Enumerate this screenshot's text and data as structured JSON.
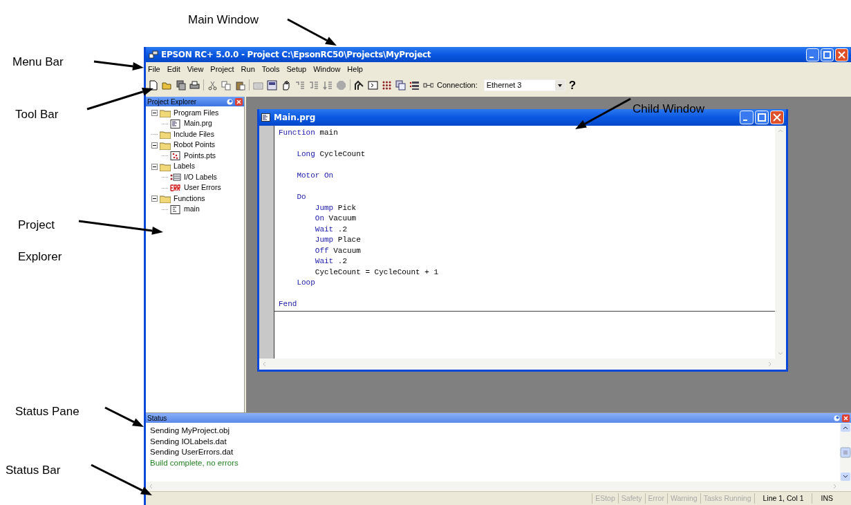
{
  "annotations": [
    {
      "label": "Main Window"
    },
    {
      "label": "Menu Bar"
    },
    {
      "label": "Tool Bar"
    },
    {
      "label": "Child Window"
    },
    {
      "label": "Project Explorer"
    },
    {
      "label": "Status Pane"
    },
    {
      "label": "Status Bar"
    }
  ],
  "window": {
    "title": "EPSON RC+ 5.0.0 - Project C:\\EpsonRC50\\Projects\\MyProject"
  },
  "menu": [
    "File",
    "Edit",
    "View",
    "Project",
    "Run",
    "Tools",
    "Setup",
    "Window",
    "Help"
  ],
  "toolbar": {
    "connection_label": "Connection:",
    "connection_value": "Ethernet 3",
    "help": "?"
  },
  "project_explorer": {
    "title": "Project Explorer",
    "tree": [
      {
        "label": "Program Files",
        "kind": "folder",
        "expanded": true,
        "children": [
          {
            "label": "Main.prg",
            "kind": "program"
          }
        ]
      },
      {
        "label": "Include Files",
        "kind": "folder"
      },
      {
        "label": "Robot Points",
        "kind": "folder",
        "expanded": true,
        "children": [
          {
            "label": "Points.pts",
            "kind": "points"
          }
        ]
      },
      {
        "label": "Labels",
        "kind": "folder",
        "expanded": true,
        "children": [
          {
            "label": "I/O Labels",
            "kind": "io"
          },
          {
            "label": "User Errors",
            "kind": "errors"
          }
        ]
      },
      {
        "label": "Functions",
        "kind": "folder",
        "expanded": true,
        "children": [
          {
            "label": "main",
            "kind": "function"
          }
        ]
      }
    ]
  },
  "editor": {
    "title": "Main.prg",
    "lines": [
      {
        "kind": "code",
        "tokens": [
          {
            "text": "Function",
            "kind": "keyword"
          },
          {
            "text": " main",
            "kind": "plain"
          }
        ]
      },
      {
        "kind": "blank"
      },
      {
        "kind": "code",
        "tokens": [
          {
            "text": "    Long",
            "kind": "keyword"
          },
          {
            "text": " CycleCount",
            "kind": "plain"
          }
        ]
      },
      {
        "kind": "blank"
      },
      {
        "kind": "code",
        "tokens": [
          {
            "text": "    Motor On",
            "kind": "keyword"
          }
        ]
      },
      {
        "kind": "blank"
      },
      {
        "kind": "code",
        "tokens": [
          {
            "text": "    Do",
            "kind": "keyword"
          }
        ]
      },
      {
        "kind": "code",
        "tokens": [
          {
            "text": "        Jump",
            "kind": "keyword"
          },
          {
            "text": " Pick",
            "kind": "plain"
          }
        ]
      },
      {
        "kind": "code",
        "tokens": [
          {
            "text": "        On",
            "kind": "keyword"
          },
          {
            "text": " Vacuum",
            "kind": "plain"
          }
        ]
      },
      {
        "kind": "code",
        "tokens": [
          {
            "text": "        Wait",
            "kind": "keyword"
          },
          {
            "text": " .2",
            "kind": "plain"
          }
        ]
      },
      {
        "kind": "code",
        "tokens": [
          {
            "text": "        Jump",
            "kind": "keyword"
          },
          {
            "text": " Place",
            "kind": "plain"
          }
        ]
      },
      {
        "kind": "code",
        "tokens": [
          {
            "text": "        Off",
            "kind": "keyword"
          },
          {
            "text": " Vacuum",
            "kind": "plain"
          }
        ]
      },
      {
        "kind": "code",
        "tokens": [
          {
            "text": "        Wait",
            "kind": "keyword"
          },
          {
            "text": " .2",
            "kind": "plain"
          }
        ]
      },
      {
        "kind": "code",
        "tokens": [
          {
            "text": "        CycleCount = CycleCount + 1",
            "kind": "plain"
          }
        ]
      },
      {
        "kind": "code",
        "tokens": [
          {
            "text": "    Loop",
            "kind": "keyword"
          }
        ]
      },
      {
        "kind": "blank"
      },
      {
        "kind": "code",
        "tokens": [
          {
            "text": "Fend",
            "kind": "keyword"
          }
        ]
      }
    ]
  },
  "status_pane": {
    "title": "Status",
    "lines": [
      {
        "text": "Sending MyProject.obj",
        "kind": "message"
      },
      {
        "text": "Sending IOLabels.dat",
        "kind": "message"
      },
      {
        "text": "Sending UserErrors.dat",
        "kind": "message"
      },
      {
        "text": "Build complete, no errors",
        "kind": "success"
      }
    ]
  },
  "status_bar": [
    {
      "label": "EStop",
      "disabled": true
    },
    {
      "label": "Safety",
      "disabled": true
    },
    {
      "label": "Error",
      "disabled": true
    },
    {
      "label": "Warning",
      "disabled": true
    },
    {
      "label": "Tasks Running",
      "disabled": true
    },
    {
      "label": "Line 1, Col 1",
      "disabled": false
    },
    {
      "label": "INS",
      "disabled": false
    }
  ]
}
